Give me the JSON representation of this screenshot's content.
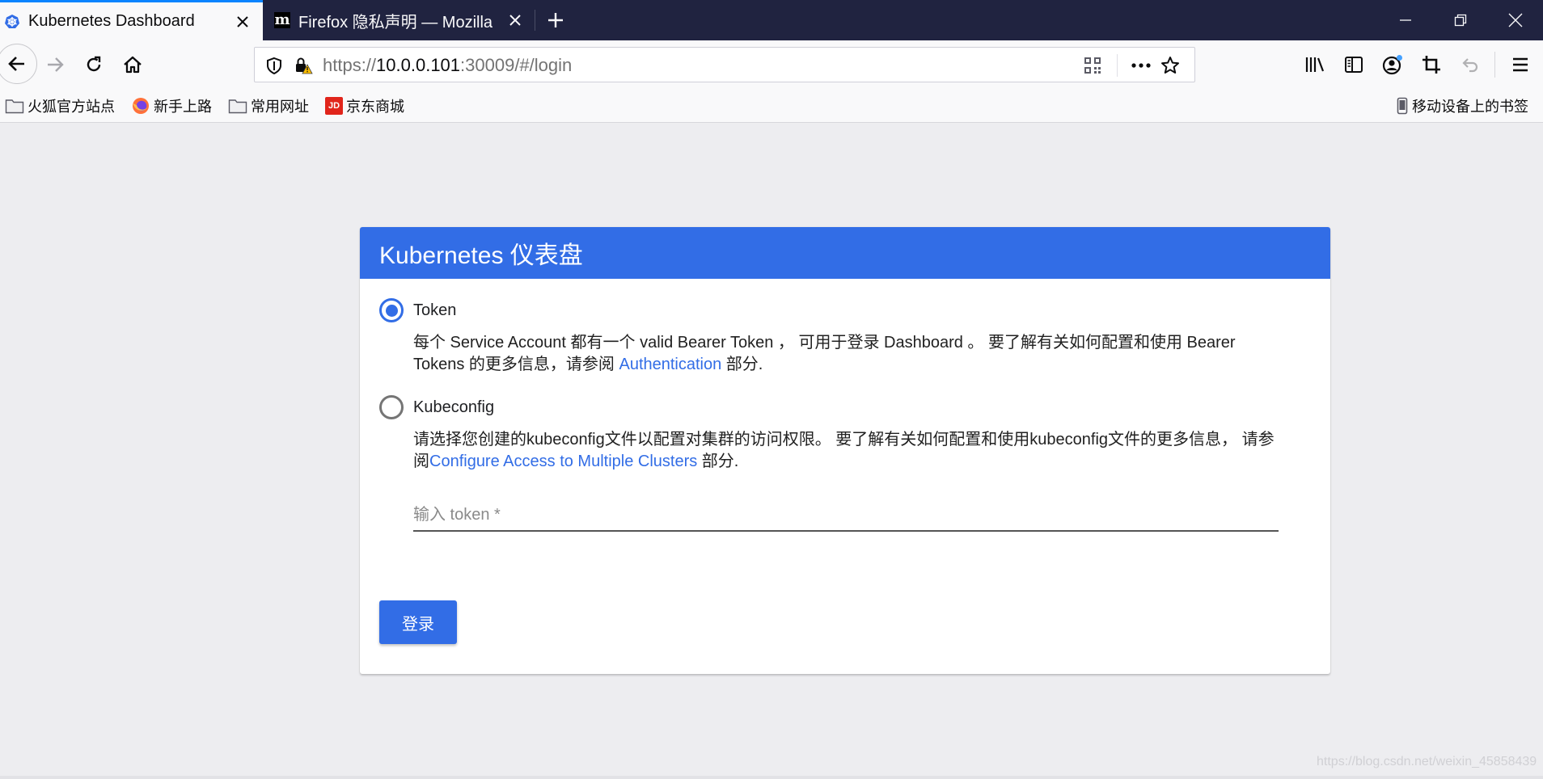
{
  "browser": {
    "tabs": [
      {
        "title": "Kubernetes Dashboard",
        "active": true
      },
      {
        "title": "Firefox 隐私声明 — Mozilla",
        "active": false
      }
    ],
    "favicon_letter": "m",
    "url": {
      "scheme": "https://",
      "host": "10.0.0.101",
      "rest": ":30009/#/login"
    },
    "bookmarks": [
      {
        "label": "火狐官方站点",
        "icon": "folder-icon"
      },
      {
        "label": "新手上路",
        "icon": "firefox-icon"
      },
      {
        "label": "常用网址",
        "icon": "folder-icon"
      },
      {
        "label": "京东商城",
        "icon": "jd-icon"
      }
    ],
    "jd_letters": "JD",
    "mobile_bookmarks": "移动设备上的书签",
    "accent": "#0a84ff",
    "tabstrip_color": "#202340"
  },
  "login": {
    "title": "Kubernetes 仪表盘",
    "header_color": "#326de6",
    "token_option": {
      "label": "Token",
      "selected": true,
      "desc_before": "每个 Service Account 都有一个 valid Bearer Token ， 可用于登录 Dashboard 。 要了解有关如何配置和使用 Bearer Tokens 的更多信息，请参阅 ",
      "link": "Authentication",
      "desc_after": " 部分."
    },
    "kubeconfig_option": {
      "label": "Kubeconfig",
      "selected": false,
      "desc_before": "请选择您创建的kubeconfig文件以配置对集群的访问权限。 要了解有关如何配置和使用kubeconfig文件的更多信息， 请参阅",
      "link": "Configure Access to Multiple Clusters",
      "desc_after": " 部分."
    },
    "token_input": {
      "placeholder": "输入 token *",
      "value": ""
    },
    "signin_label": "登录"
  },
  "watermark": "https://blog.csdn.net/weixin_45858439"
}
